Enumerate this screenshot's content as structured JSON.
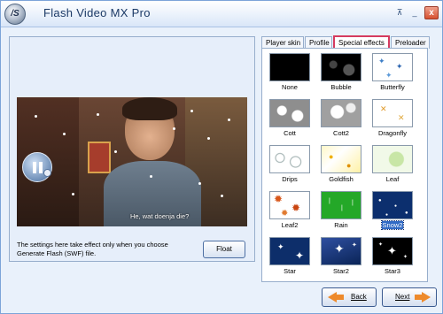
{
  "window": {
    "title": "Flash Video MX Pro",
    "app_icon_letter": "/S",
    "controls": {
      "tray": "⊼",
      "minimize": "_",
      "close": "x"
    }
  },
  "preview": {
    "caption": "He, wat doenja die?",
    "note": "The settings here take effect only when you choose Generate Flash (SWF) file.",
    "float_label": "Float"
  },
  "tabs": [
    {
      "label": "Player skin"
    },
    {
      "label": "Profile"
    },
    {
      "label": "Special effects",
      "active": true
    },
    {
      "label": "Preloader"
    }
  ],
  "effects": [
    {
      "label": "None"
    },
    {
      "label": "Bubble"
    },
    {
      "label": "Butterfly"
    },
    {
      "label": "Cott"
    },
    {
      "label": "Cott2"
    },
    {
      "label": "Dragonfly"
    },
    {
      "label": "Drips"
    },
    {
      "label": "Goldfish"
    },
    {
      "label": "Leaf"
    },
    {
      "label": "Leaf2"
    },
    {
      "label": "Rain"
    },
    {
      "label": "Snow2",
      "selected": true
    },
    {
      "label": "Star"
    },
    {
      "label": "Star2"
    },
    {
      "label": "Star3"
    }
  ],
  "footer": {
    "back_label": "Back",
    "next_label": "Next"
  },
  "colors": {
    "accent": "#d53b5f",
    "selection": "#316ac5",
    "arrow": "#ee8a2b"
  }
}
